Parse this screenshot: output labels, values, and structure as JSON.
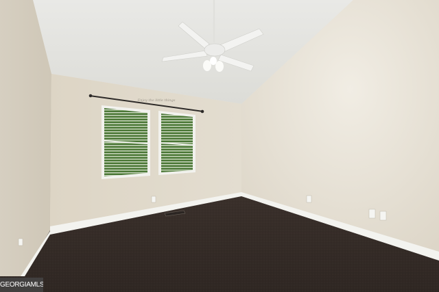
{
  "photo": {
    "subject": "empty-bedroom",
    "wall_color": "#ddd7ca",
    "ceiling_color": "#e6e6e2",
    "carpet_color": "#3d332d",
    "trim_color": "#f4f4f0",
    "fan_color": "#f1f1ef"
  },
  "wall_decal": {
    "text": "Enjoy the little things"
  },
  "watermark": {
    "brand": "GEORGIAMLS"
  }
}
